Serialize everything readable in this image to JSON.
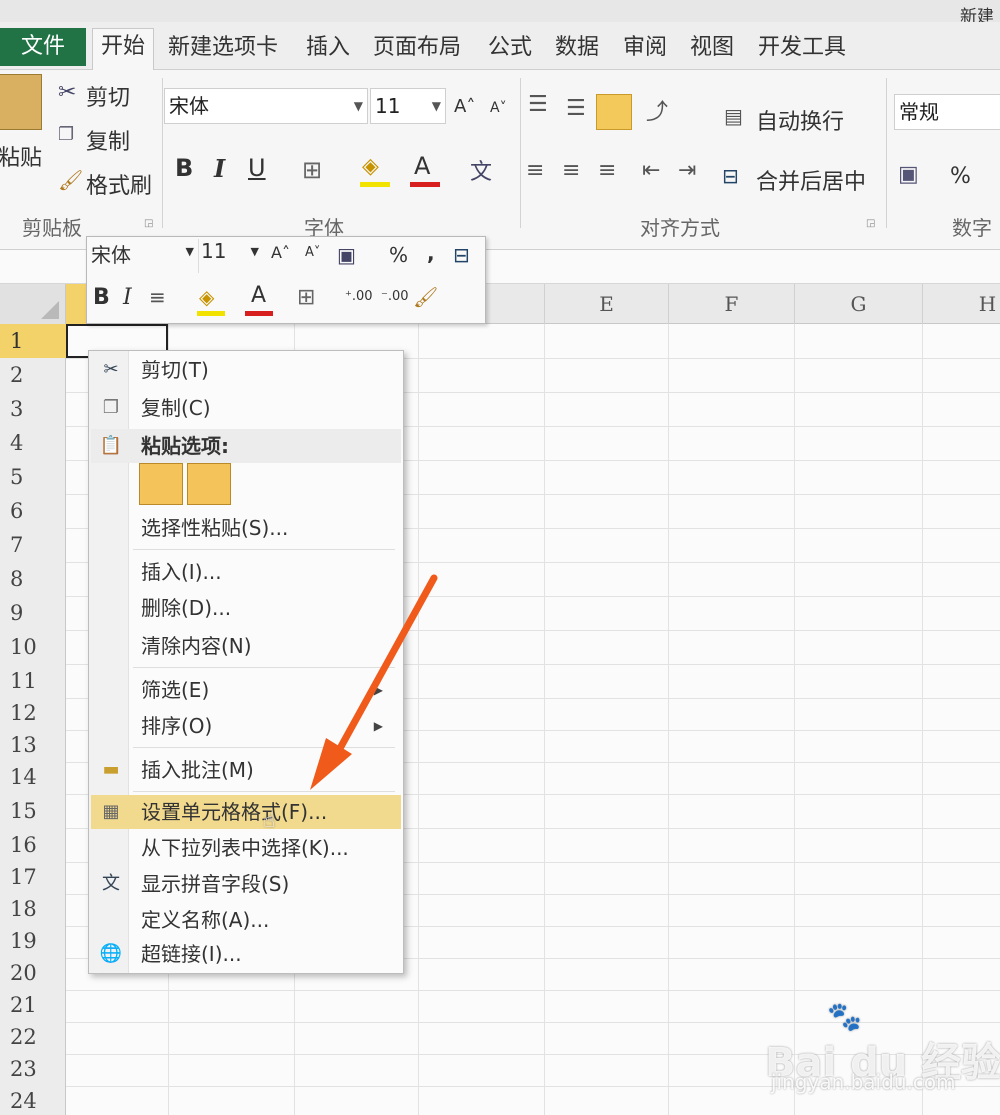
{
  "window": {
    "title_fragment": "新建"
  },
  "tabs": [
    "文件",
    "开始",
    "新建选项卡",
    "插入",
    "页面布局",
    "公式",
    "数据",
    "审阅",
    "视图",
    "开发工具"
  ],
  "ribbon": {
    "clipboard": {
      "paste": "粘贴",
      "cut": "剪切",
      "copy": "复制",
      "format_painter": "格式刷",
      "group": "剪贴板"
    },
    "font": {
      "name": "宋体",
      "size": "11",
      "bold": "B",
      "italic": "I",
      "underline": "U",
      "font_color_glyph": "A",
      "group": "字体"
    },
    "alignment": {
      "wrap_text": "自动换行",
      "merge_center": "合并后居中",
      "group": "对齐方式"
    },
    "number": {
      "format": "常规",
      "percent": "%",
      "group": "数字"
    }
  },
  "mini_toolbar": {
    "font": "宋体",
    "size": "11",
    "bold": "B",
    "italic": "I",
    "percent": "%",
    "comma": ",",
    "font_color_glyph": "A"
  },
  "columns": [
    "E",
    "F",
    "G",
    "H"
  ],
  "rows": [
    "1",
    "2",
    "3",
    "4",
    "5",
    "6",
    "7",
    "8",
    "9",
    "10",
    "11",
    "12",
    "13",
    "14",
    "15",
    "16",
    "17",
    "18",
    "19",
    "20",
    "21",
    "22",
    "23",
    "24"
  ],
  "context_menu": {
    "cut": "剪切(T)",
    "copy": "复制(C)",
    "paste_options": "粘贴选项:",
    "paste_special": "选择性粘贴(S)...",
    "insert": "插入(I)...",
    "delete": "删除(D)...",
    "clear": "清除内容(N)",
    "filter": "筛选(E)",
    "sort": "排序(O)",
    "insert_comment": "插入批注(M)",
    "format_cells": "设置单元格格式(F)...",
    "pick_list": "从下拉列表中选择(K)...",
    "phonetic": "显示拼音字段(S)",
    "define_name": "定义名称(A)...",
    "hyperlink": "超链接(I)..."
  },
  "watermark": {
    "brand": "Bai du 经验",
    "url": "jingyan.baidu.com"
  },
  "colors": {
    "file_tab": "#217346",
    "highlight": "#f1d98d",
    "selected_row": "#f3d26a",
    "arrow": "#f05a1a"
  }
}
